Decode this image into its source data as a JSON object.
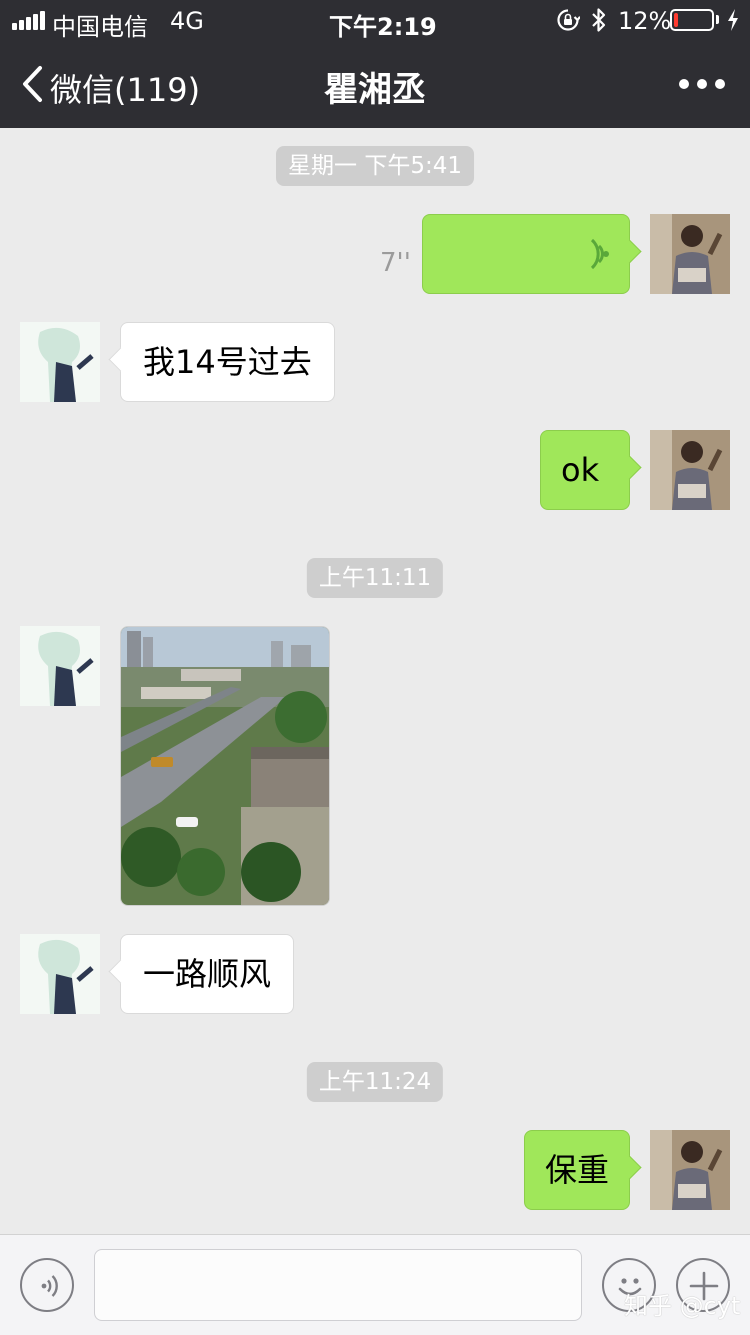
{
  "status_bar": {
    "carrier": "中国电信",
    "network": "4G",
    "time": "下午2:19",
    "battery_percent": "12%",
    "battery_level": 0.12
  },
  "nav": {
    "back_label": "微信(119)",
    "title": "瞿湘丞"
  },
  "messages": [
    {
      "type": "timestamp",
      "text": "星期一 下午5:41"
    },
    {
      "type": "voice",
      "sender": "me",
      "duration": "7''"
    },
    {
      "type": "text",
      "sender": "them",
      "text": "我14号过去"
    },
    {
      "type": "text",
      "sender": "me",
      "text": "ok"
    },
    {
      "type": "timestamp",
      "text": "上午11:11"
    },
    {
      "type": "image",
      "sender": "them"
    },
    {
      "type": "text",
      "sender": "them",
      "text": "一路顺风"
    },
    {
      "type": "timestamp",
      "text": "上午11:24"
    },
    {
      "type": "text",
      "sender": "me",
      "text": "保重"
    }
  ],
  "input_bar": {
    "value": "",
    "placeholder": ""
  },
  "watermark": "知乎 @cyt",
  "colors": {
    "nav_bg": "#2e2e33",
    "chat_bg": "#ebebeb",
    "my_bubble": "#a0e75a",
    "their_bubble": "#ffffff",
    "voice_icon": "#5aa83a",
    "battery_low": "#ff3b30"
  },
  "icons": [
    "signal-icon",
    "lock-rotation-icon",
    "bluetooth-icon",
    "battery-icon",
    "charging-icon",
    "back-chevron-icon",
    "more-icon",
    "voice-wave-icon",
    "voice-input-icon",
    "emoji-icon",
    "plus-icon"
  ]
}
